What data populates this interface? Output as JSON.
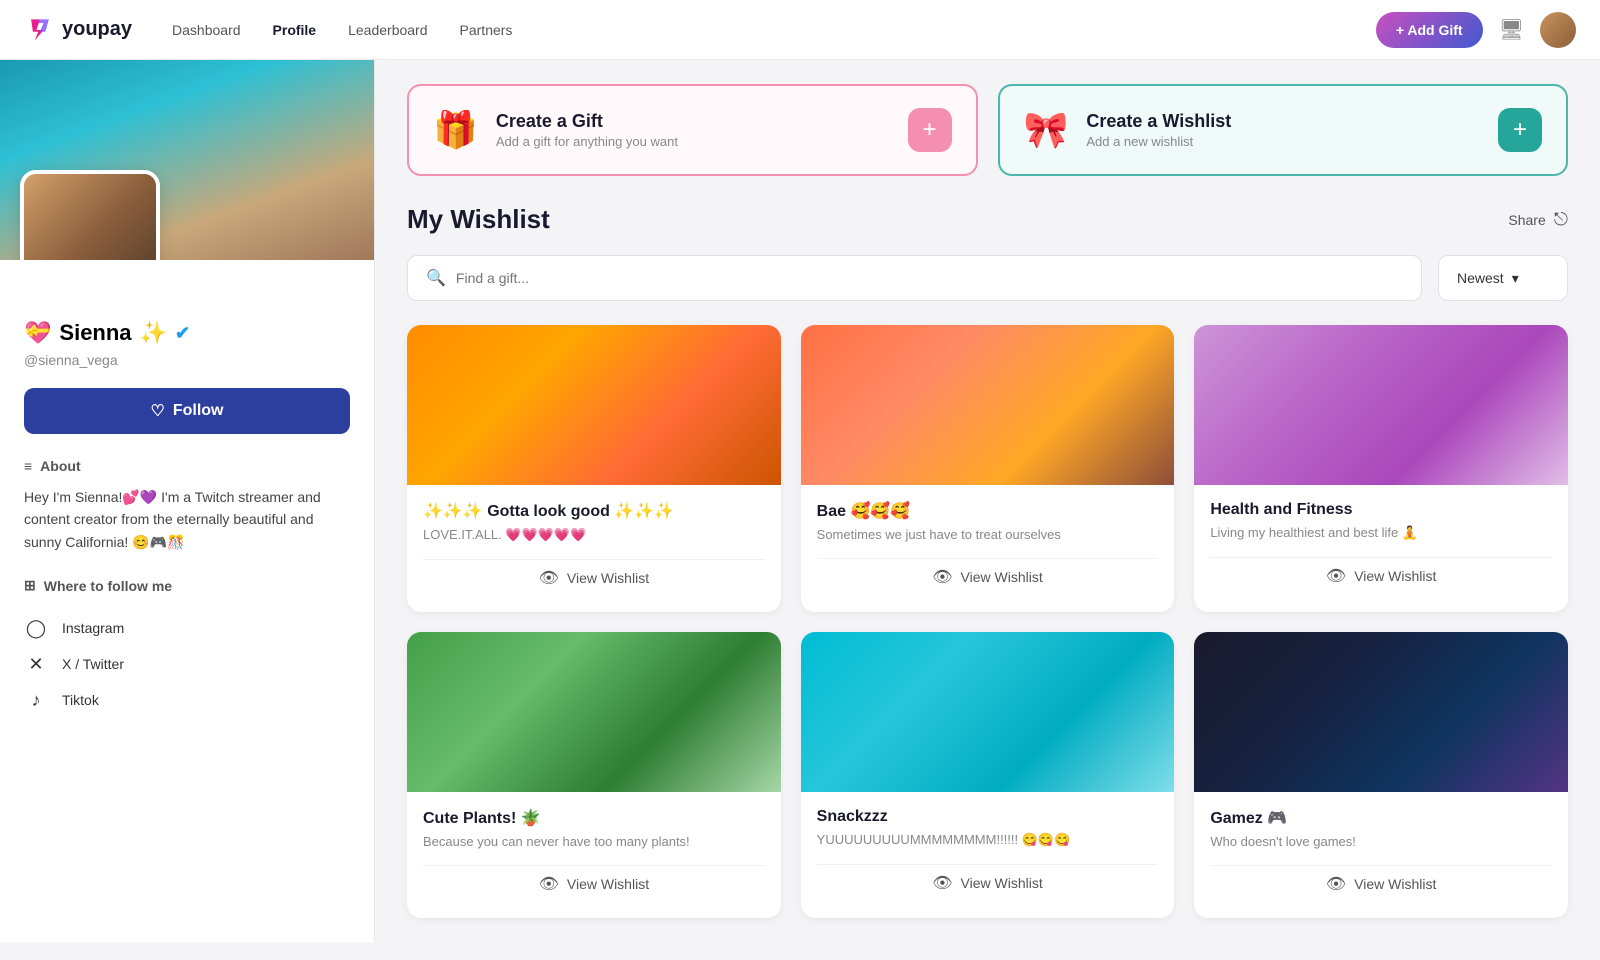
{
  "nav": {
    "logo_text": "youpay",
    "links": [
      {
        "label": "Dashboard",
        "active": false
      },
      {
        "label": "Profile",
        "active": true
      },
      {
        "label": "Leaderboard",
        "active": false
      },
      {
        "label": "Partners",
        "active": false
      }
    ],
    "add_gift_label": "+ Add Gift"
  },
  "sidebar": {
    "profile_name": "Sienna",
    "name_emoji": "💝",
    "sparkle_emoji": "✨",
    "handle": "@sienna_vega",
    "follow_label": "Follow",
    "about_label": "About",
    "about_text": "Hey I'm Sienna!💕💜 I'm a Twitch streamer and content creator from the eternally beautiful and sunny California! 😊🎮🎊",
    "social_label": "Where to follow me",
    "socials": [
      {
        "name": "Instagram",
        "icon": "📷"
      },
      {
        "name": "X / Twitter",
        "icon": "✖"
      },
      {
        "name": "Tiktok",
        "icon": "🎵"
      }
    ]
  },
  "create_gift": {
    "title": "Create a Gift",
    "subtitle": "Add a gift for anything you want",
    "plus": "+"
  },
  "create_wishlist": {
    "title": "Create a Wishlist",
    "subtitle": "Add a new wishlist",
    "plus": "+"
  },
  "wishlist_section": {
    "title": "My Wishlist",
    "share_label": "Share",
    "search_placeholder": "Find a gift...",
    "sort_label": "Newest",
    "items": [
      {
        "name": "✨✨✨ Gotta look good ✨✨✨",
        "desc": "LOVE.IT.ALL. 💗💗💗💗💗",
        "img_class": "img-orange",
        "view_label": "View Wishlist"
      },
      {
        "name": "Bae 🥰🥰🥰",
        "desc": "Sometimes we just have to treat ourselves",
        "img_class": "img-sunset",
        "view_label": "View Wishlist"
      },
      {
        "name": "Health and Fitness",
        "desc": "Living my healthiest and best life 🧘",
        "img_class": "img-purple",
        "view_label": "View Wishlist"
      },
      {
        "name": "Cute Plants! 🪴",
        "desc": "Because you can never have too many plants!",
        "img_class": "img-green",
        "view_label": "View Wishlist"
      },
      {
        "name": "Snackzzz",
        "desc": "YUUUUUUUUUMMMMMMMM!!!!!! 😋😋😋",
        "img_class": "img-donut",
        "view_label": "View Wishlist"
      },
      {
        "name": "Gamez 🎮",
        "desc": "Who doesn't love games!",
        "img_class": "img-keyboard",
        "view_label": "View Wishlist"
      }
    ]
  }
}
